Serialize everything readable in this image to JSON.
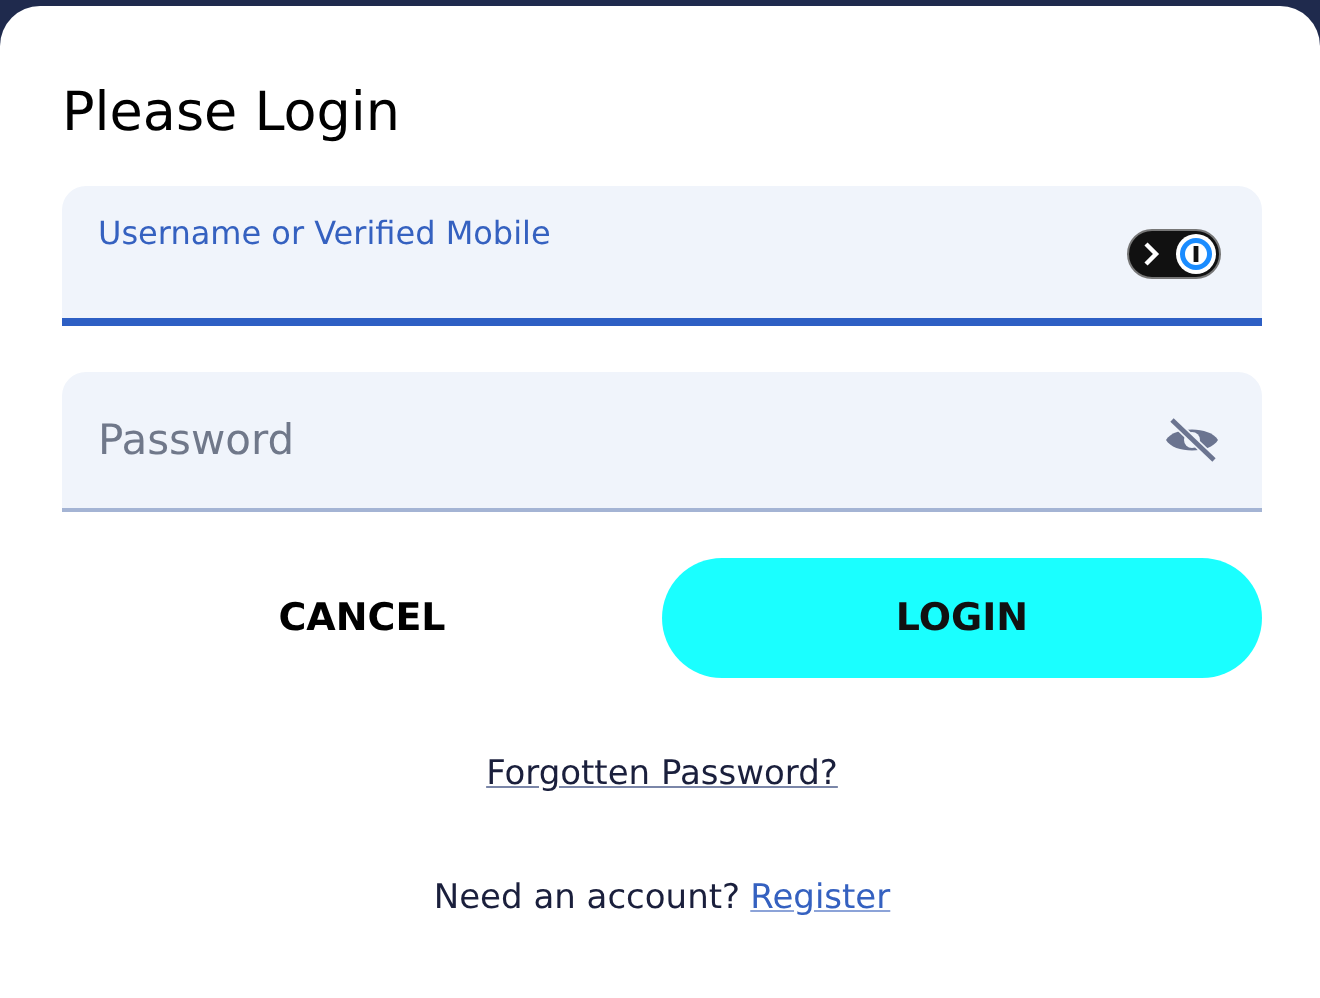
{
  "dialog": {
    "title": "Please Login"
  },
  "fields": [
    {
      "kind": "text",
      "label": "Username or Verified Mobile",
      "focused": true
    },
    {
      "kind": "password",
      "placeholder": "Password",
      "focused": false
    }
  ],
  "buttons": [
    {
      "label": "CANCEL",
      "kind": "secondary"
    },
    {
      "label": "LOGIN",
      "kind": "primary"
    }
  ],
  "forgot_link": "Forgotten Password?",
  "register": {
    "prompt": "Need an account?",
    "link": "Register"
  }
}
